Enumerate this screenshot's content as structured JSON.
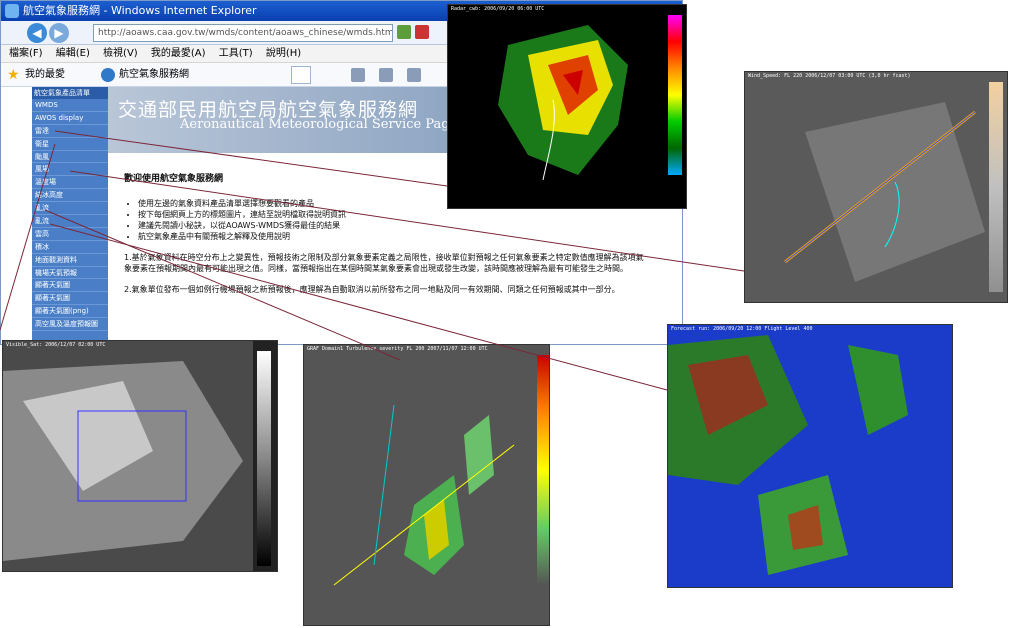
{
  "browser": {
    "title": "航空氣象服務網 - Windows Internet Explorer",
    "url": "http://aoaws.caa.gov.tw/wmds/content/aoaws_chinese/wmds.html",
    "menu": [
      "檔案(F)",
      "編輯(E)",
      "檢視(V)",
      "我的最愛(A)",
      "工具(T)",
      "說明(H)"
    ],
    "favorites_label": "我的最愛",
    "tab_label": "航空氣象服務網"
  },
  "sidebar": {
    "header": "航空氣象產品清單",
    "items": [
      "WMDS",
      "AWOS display",
      "雷達",
      "衛星",
      "颱風",
      "風場",
      "溫度場",
      "結冰高度",
      "亂流",
      "亂流",
      "雲高",
      "積冰",
      "地面觀測資料",
      "機場天氣預報",
      "顯著天氣圖",
      "顯著天氣圖",
      "顯著天氣圖(png)",
      "高空風及溫度預報圖"
    ]
  },
  "page": {
    "banner_cn": "交通部民用航空局航空氣象服務網",
    "banner_en": "Aeronautical Meteorological Service Page",
    "welcome": "歡迎使用航空氣象服務網",
    "bullets": [
      "使用左邊的氣象資料產品清單選擇想要觀看的產品",
      "按下每個網頁上方的標題圖片，連結至說明檔取得說明資訊",
      "建議先閱讀小秘訣，以從AOAWS-WMDS獲得最佳的結果",
      "航空氣象產品中有關預報之解釋及使用說明"
    ],
    "para1": "1.基於氣象資料在時空分布上之變異性，預報技術之限制及部分氣象要素定義之局限性，接收單位對預報之任何氣象要素之特定數值應理解為該項氣象要素在預報期間內最有可能出現之值。同樣，當預報指出在某個時間某氣象要素會出現或發生改變，該時間應被理解為最有可能發生之時間。",
    "para2": "2.氣象單位發布一個如例行機場預報之新預報後，應理解為自動取消以前所發布之同一地點及同一有效期間、同類之任何預報或其中一部分。"
  },
  "images": {
    "radar_caption": "Radar_cwb: 2006/09/20 06:00 UTC",
    "wind_caption": "Wind_Speed: FL 220 2006/12/07 03:00 UTC (3,0 hr fcast)",
    "sat_caption": "Visible_Sat: 2006/12/07 02:00 UTC",
    "turb_caption": "GRAF Domain1 Turbulence severity FL 200 2007/11/07 12:00 UTC",
    "forecast_caption": "Forecast run: 2006/09/20 12:00  Flight Level 400"
  },
  "colors": {
    "sidebar_bg": "#4a7fc8",
    "titlebar": "#0a3fb0",
    "arrow": "#7a2638"
  }
}
